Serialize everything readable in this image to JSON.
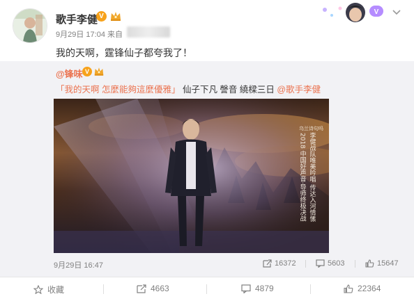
{
  "user": {
    "name": "歌手李健",
    "verified_mark": "V",
    "post_time": "9月29日 17:04",
    "source_label": "来自",
    "text": "我的天啊，霆锋仙子都夸我了！"
  },
  "repost": {
    "author": "@锋味",
    "verified_mark": "V",
    "quote": "「我的天啊 怎麼能夠這麼優雅」",
    "text_rest": " 仙子下凡 謦音 繞樑三日",
    "mention": "@歌手李健",
    "video": {
      "tag": "乌兰诗句吗",
      "caption_cols": [
        "2018 中国好声音·导师终极决战",
        "李健战队唯美吟唱 传达入河情愫"
      ]
    },
    "date": "9月29日 16:47",
    "reposts": "16372",
    "comments": "5603",
    "likes": "15647"
  },
  "actions": {
    "favorite": "收藏",
    "reposts": "4663",
    "comments": "4879",
    "likes": "22364"
  },
  "colors": {
    "accent": "#eb7350",
    "badge": "#f7a21b",
    "muted": "#808080",
    "repost_bg": "#f2f2f5"
  }
}
